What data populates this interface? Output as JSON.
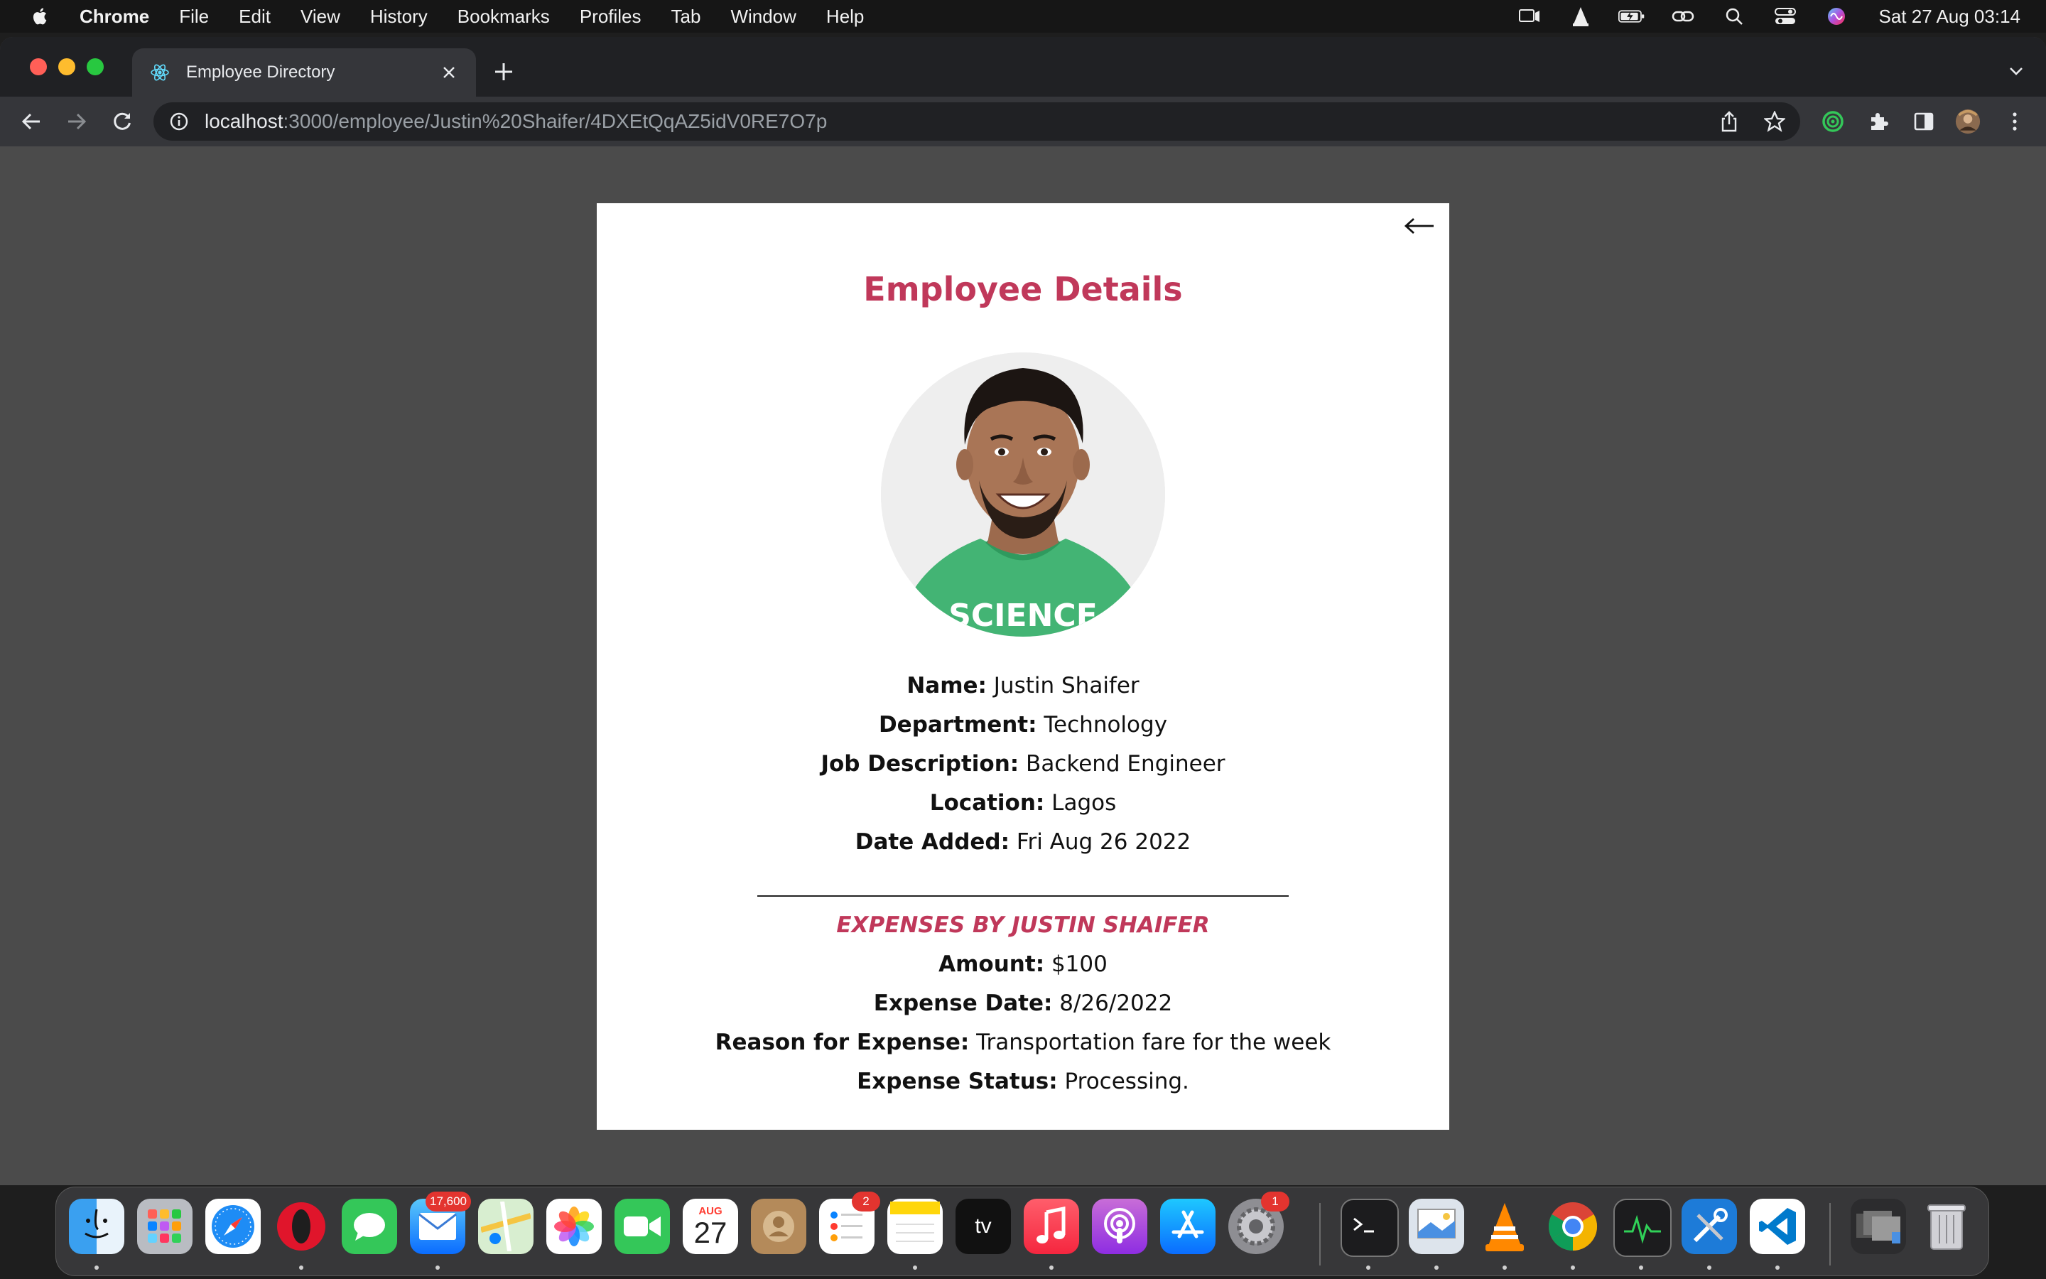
{
  "menubar": {
    "app_name": "Chrome",
    "items": [
      "File",
      "Edit",
      "View",
      "History",
      "Bookmarks",
      "Profiles",
      "Tab",
      "Window",
      "Help"
    ],
    "clock": "Sat 27 Aug  03:14"
  },
  "browser": {
    "tab_title": "Employee Directory",
    "url_host": "localhost",
    "url_path": ":3000/employee/Justin%20Shaifer/4DXEtQqAZ5idV0RE7O7p"
  },
  "page": {
    "title": "Employee Details",
    "details": [
      {
        "label": "Name:",
        "value": "Justin Shaifer"
      },
      {
        "label": "Department:",
        "value": "Technology"
      },
      {
        "label": "Job Description:",
        "value": "Backend Engineer"
      },
      {
        "label": "Location:",
        "value": "Lagos"
      },
      {
        "label": "Date Added:",
        "value": "Fri Aug 26 2022"
      }
    ],
    "expenses_title": "EXPENSES BY JUSTIN SHAIFER",
    "expenses": [
      {
        "label": "Amount:",
        "value": "$100"
      },
      {
        "label": "Expense Date:",
        "value": "8/26/2022"
      },
      {
        "label": "Reason for Expense:",
        "value": "Transportation fare for the week"
      },
      {
        "label": "Expense Status:",
        "value": "Processing."
      }
    ],
    "avatar_shirt_text": "SCIENCE"
  },
  "dock": {
    "mail_badge": "17,600",
    "calendar_month": "AUG",
    "calendar_day": "27",
    "reminders_badge": "2",
    "settings_badge": "1",
    "tv_label": "tv"
  },
  "colors": {
    "accent": "#c0385a",
    "page_background": "#4b4b4b",
    "card_background": "#ffffff"
  }
}
